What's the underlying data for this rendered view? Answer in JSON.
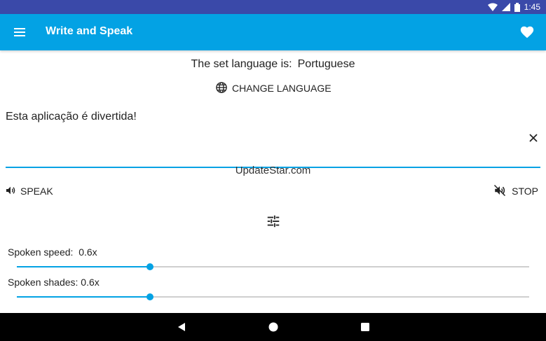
{
  "status_bar": {
    "time": "1:45",
    "icons": [
      "wifi-icon",
      "signal-icon",
      "battery-icon"
    ]
  },
  "app_bar": {
    "title": "Write and Speak",
    "menu_icon": "menu-icon",
    "favorite_icon": "heart-icon",
    "color": "#03a2e4"
  },
  "language": {
    "prefix": "The set language is:",
    "value": "Portuguese",
    "change_label": "CHANGE LANGUAGE",
    "change_icon": "globe-icon"
  },
  "editor": {
    "text": "Esta aplicação é divertida!",
    "clear_icon": "close-icon"
  },
  "watermark": "UpdateStar.com",
  "controls": {
    "speak_label": "SPEAK",
    "speak_icon": "volume-icon",
    "stop_label": "STOP",
    "stop_icon": "volume-off-icon",
    "settings_icon": "tune-icon"
  },
  "sliders": [
    {
      "label": "Spoken speed:",
      "value_text": "0.6x",
      "fraction": 0.26
    },
    {
      "label": "Spoken shades:",
      "value_text": "0.6x",
      "fraction": 0.26
    }
  ],
  "nav_bar": {
    "icons": [
      "back-icon",
      "home-icon",
      "recents-icon"
    ]
  }
}
